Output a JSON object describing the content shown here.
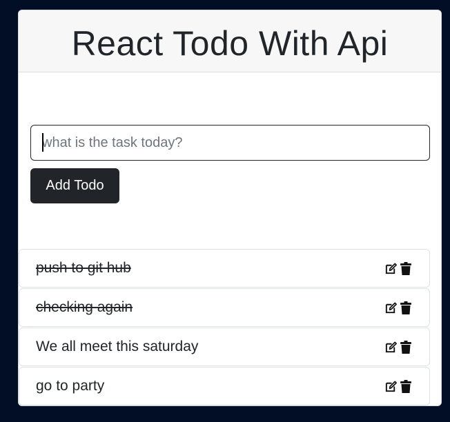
{
  "header": {
    "title": "React Todo With Api"
  },
  "form": {
    "placeholder": "what is the task today?",
    "value": "",
    "add_label": "Add Todo"
  },
  "todos": [
    {
      "text": "push to git hub",
      "completed": true
    },
    {
      "text": "checking again",
      "completed": true
    },
    {
      "text": "We all meet this saturday",
      "completed": false
    },
    {
      "text": "go to party",
      "completed": false
    }
  ],
  "icons": {
    "edit": "edit-icon",
    "delete": "trash-icon"
  },
  "colors": {
    "background": "#020d26",
    "button": "#212529",
    "header_bg": "#f7f7f7"
  }
}
